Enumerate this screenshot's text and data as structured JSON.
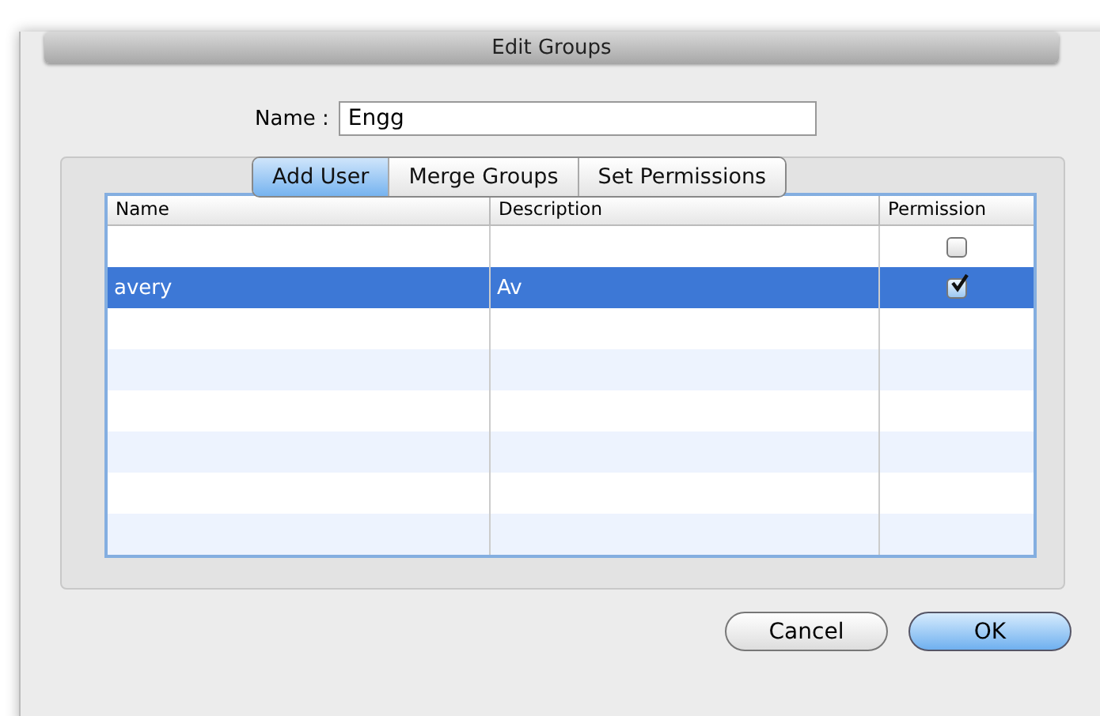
{
  "window": {
    "title": "Edit Groups"
  },
  "name_field": {
    "label": "Name :",
    "value": "Engg"
  },
  "tabs": [
    {
      "label": "Add User",
      "selected": true
    },
    {
      "label": "Merge Groups",
      "selected": false
    },
    {
      "label": "Set Permissions",
      "selected": false
    }
  ],
  "table": {
    "columns": [
      "Name",
      "Description",
      "Permission"
    ],
    "rows": [
      {
        "name": "",
        "description": "",
        "permission": false,
        "selected": false
      },
      {
        "name": "avery",
        "description": "Av",
        "permission": true,
        "selected": true
      }
    ]
  },
  "buttons": [
    {
      "label": "Cancel",
      "default": false
    },
    {
      "label": "OK",
      "default": true
    }
  ]
}
